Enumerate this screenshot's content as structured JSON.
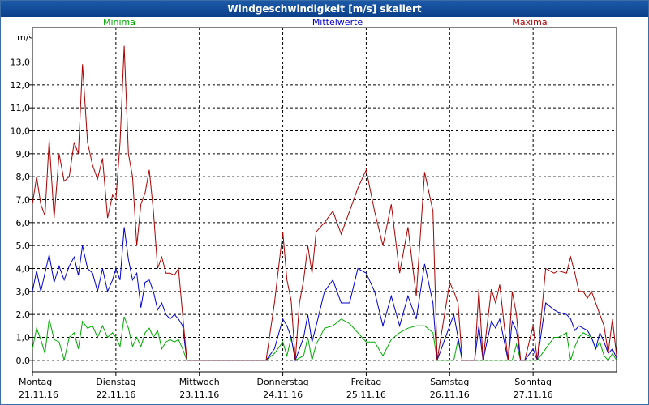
{
  "window": {
    "title": "Windgeschwindigkeit [m/s] skaliert"
  },
  "chart_data": {
    "type": "line",
    "ylabel": "m/s",
    "ylim": [
      -0.5,
      14.5
    ],
    "yticks": [
      "0,0",
      "1,0",
      "2,0",
      "3,0",
      "4,0",
      "5,0",
      "6,0",
      "7,0",
      "8,0",
      "9,0",
      "10,0",
      "11,0",
      "12,0",
      "13,0"
    ],
    "grid": true,
    "legend_position": "top",
    "xlim": [
      0,
      7
    ],
    "day_labels": [
      {
        "day": "Montag",
        "date": "21.11.16"
      },
      {
        "day": "Dienstag",
        "date": "22.11.16"
      },
      {
        "day": "Mittwoch",
        "date": "23.11.16"
      },
      {
        "day": "Donnerstag",
        "date": "24.11.16"
      },
      {
        "day": "Freitag",
        "date": "25.11.16"
      },
      {
        "day": "Samstag",
        "date": "26.11.16"
      },
      {
        "day": "Sonntag",
        "date": "27.11.16"
      }
    ],
    "series": [
      {
        "name": "Minima",
        "color": "#00aa00",
        "points": [
          [
            0,
            0.5
          ],
          [
            0.05,
            1.4
          ],
          [
            0.1,
            0.9
          ],
          [
            0.15,
            0.3
          ],
          [
            0.2,
            1.8
          ],
          [
            0.26,
            0.9
          ],
          [
            0.32,
            0.8
          ],
          [
            0.38,
            0.0
          ],
          [
            0.44,
            1.0
          ],
          [
            0.5,
            1.2
          ],
          [
            0.55,
            0.5
          ],
          [
            0.6,
            1.7
          ],
          [
            0.66,
            1.4
          ],
          [
            0.72,
            1.5
          ],
          [
            0.78,
            1.0
          ],
          [
            0.84,
            1.5
          ],
          [
            0.9,
            1.0
          ],
          [
            0.96,
            1.2
          ],
          [
            1.0,
            1.0
          ],
          [
            1.05,
            0.6
          ],
          [
            1.1,
            1.9
          ],
          [
            1.15,
            1.4
          ],
          [
            1.2,
            0.6
          ],
          [
            1.25,
            1.0
          ],
          [
            1.3,
            0.6
          ],
          [
            1.35,
            1.2
          ],
          [
            1.4,
            1.4
          ],
          [
            1.45,
            1.0
          ],
          [
            1.5,
            1.3
          ],
          [
            1.55,
            0.5
          ],
          [
            1.6,
            0.8
          ],
          [
            1.65,
            0.9
          ],
          [
            1.7,
            0.8
          ],
          [
            1.75,
            0.9
          ],
          [
            1.8,
            0.5
          ],
          [
            1.85,
            0.0
          ],
          [
            1.9,
            0.0
          ],
          [
            2.0,
            0.0
          ],
          [
            2.8,
            0.0
          ],
          [
            2.9,
            0.3
          ],
          [
            3.0,
            0.8
          ],
          [
            3.05,
            0.2
          ],
          [
            3.1,
            1.0
          ],
          [
            3.15,
            0.0
          ],
          [
            3.2,
            0.1
          ],
          [
            3.25,
            0.2
          ],
          [
            3.3,
            1.0
          ],
          [
            3.35,
            0.0
          ],
          [
            3.4,
            0.7
          ],
          [
            3.5,
            1.4
          ],
          [
            3.6,
            1.5
          ],
          [
            3.7,
            1.8
          ],
          [
            3.8,
            1.6
          ],
          [
            3.9,
            1.2
          ],
          [
            4.0,
            0.8
          ],
          [
            4.1,
            0.8
          ],
          [
            4.2,
            0.2
          ],
          [
            4.3,
            0.9
          ],
          [
            4.4,
            1.2
          ],
          [
            4.5,
            1.4
          ],
          [
            4.6,
            1.5
          ],
          [
            4.7,
            1.5
          ],
          [
            4.8,
            1.2
          ],
          [
            4.85,
            0.0
          ],
          [
            5.0,
            0.0
          ],
          [
            5.05,
            0.0
          ],
          [
            5.1,
            0.9
          ],
          [
            5.15,
            0.0
          ],
          [
            5.2,
            0.0
          ],
          [
            5.3,
            0.0
          ],
          [
            5.35,
            0.0
          ],
          [
            5.4,
            0.0
          ],
          [
            5.5,
            0.0
          ],
          [
            5.55,
            0.0
          ],
          [
            5.6,
            0.0
          ],
          [
            5.7,
            0.0
          ],
          [
            5.75,
            0.0
          ],
          [
            5.8,
            0.7
          ],
          [
            5.85,
            0.0
          ],
          [
            5.9,
            0.0
          ],
          [
            6.0,
            0.0
          ],
          [
            6.05,
            0.0
          ],
          [
            6.15,
            0.5
          ],
          [
            6.25,
            1.0
          ],
          [
            6.3,
            1.0
          ],
          [
            6.4,
            1.2
          ],
          [
            6.45,
            0.0
          ],
          [
            6.5,
            0.6
          ],
          [
            6.55,
            1.0
          ],
          [
            6.6,
            1.2
          ],
          [
            6.65,
            1.1
          ],
          [
            6.7,
            1.0
          ],
          [
            6.75,
            0.5
          ],
          [
            6.8,
            0.8
          ],
          [
            6.85,
            0.2
          ],
          [
            6.9,
            0.0
          ],
          [
            6.95,
            0.3
          ],
          [
            7.0,
            0.0
          ]
        ]
      },
      {
        "name": "Mittelwerte",
        "color": "#0000cc",
        "points": [
          [
            0,
            3.0
          ],
          [
            0.05,
            3.9
          ],
          [
            0.1,
            3.0
          ],
          [
            0.15,
            3.8
          ],
          [
            0.2,
            4.6
          ],
          [
            0.26,
            3.4
          ],
          [
            0.32,
            4.1
          ],
          [
            0.38,
            3.5
          ],
          [
            0.44,
            4.1
          ],
          [
            0.5,
            4.5
          ],
          [
            0.55,
            3.7
          ],
          [
            0.6,
            5.0
          ],
          [
            0.66,
            4.0
          ],
          [
            0.72,
            3.8
          ],
          [
            0.78,
            3.0
          ],
          [
            0.84,
            4.0
          ],
          [
            0.9,
            3.0
          ],
          [
            0.96,
            3.5
          ],
          [
            1.0,
            4.0
          ],
          [
            1.05,
            3.5
          ],
          [
            1.1,
            5.8
          ],
          [
            1.15,
            4.4
          ],
          [
            1.2,
            3.5
          ],
          [
            1.25,
            3.8
          ],
          [
            1.3,
            2.3
          ],
          [
            1.35,
            3.4
          ],
          [
            1.4,
            3.5
          ],
          [
            1.45,
            3.0
          ],
          [
            1.5,
            2.2
          ],
          [
            1.55,
            2.5
          ],
          [
            1.6,
            2.0
          ],
          [
            1.65,
            1.8
          ],
          [
            1.7,
            2.0
          ],
          [
            1.75,
            1.8
          ],
          [
            1.8,
            1.5
          ],
          [
            1.85,
            0.0
          ],
          [
            1.9,
            0.0
          ],
          [
            2.0,
            0.0
          ],
          [
            2.8,
            0.0
          ],
          [
            2.9,
            0.5
          ],
          [
            3.0,
            1.8
          ],
          [
            3.05,
            1.5
          ],
          [
            3.1,
            1.0
          ],
          [
            3.15,
            0.0
          ],
          [
            3.2,
            0.5
          ],
          [
            3.25,
            1.0
          ],
          [
            3.3,
            2.0
          ],
          [
            3.35,
            0.8
          ],
          [
            3.4,
            1.5
          ],
          [
            3.5,
            3.0
          ],
          [
            3.6,
            3.5
          ],
          [
            3.7,
            2.5
          ],
          [
            3.8,
            2.5
          ],
          [
            3.9,
            4.0
          ],
          [
            4.0,
            3.8
          ],
          [
            4.1,
            3.0
          ],
          [
            4.2,
            1.5
          ],
          [
            4.3,
            2.8
          ],
          [
            4.4,
            1.5
          ],
          [
            4.5,
            2.8
          ],
          [
            4.6,
            1.8
          ],
          [
            4.7,
            4.2
          ],
          [
            4.8,
            2.5
          ],
          [
            4.85,
            0.0
          ],
          [
            5.0,
            1.5
          ],
          [
            5.05,
            2.0
          ],
          [
            5.1,
            1.0
          ],
          [
            5.15,
            0.0
          ],
          [
            5.2,
            0.0
          ],
          [
            5.3,
            0.0
          ],
          [
            5.35,
            1.5
          ],
          [
            5.4,
            0.0
          ],
          [
            5.5,
            1.7
          ],
          [
            5.55,
            1.4
          ],
          [
            5.6,
            1.8
          ],
          [
            5.7,
            0.0
          ],
          [
            5.75,
            1.7
          ],
          [
            5.8,
            1.3
          ],
          [
            5.85,
            0.0
          ],
          [
            5.9,
            0.0
          ],
          [
            6.0,
            0.5
          ],
          [
            6.05,
            0.0
          ],
          [
            6.15,
            2.5
          ],
          [
            6.25,
            2.2
          ],
          [
            6.3,
            2.1
          ],
          [
            6.4,
            2.0
          ],
          [
            6.45,
            1.8
          ],
          [
            6.5,
            1.3
          ],
          [
            6.55,
            1.5
          ],
          [
            6.6,
            1.4
          ],
          [
            6.65,
            1.3
          ],
          [
            6.7,
            1.0
          ],
          [
            6.75,
            0.5
          ],
          [
            6.8,
            1.2
          ],
          [
            6.85,
            0.8
          ],
          [
            6.9,
            0.3
          ],
          [
            6.95,
            0.5
          ],
          [
            7.0,
            0.1
          ]
        ]
      },
      {
        "name": "Maxima",
        "color": "#aa0000",
        "points": [
          [
            0,
            6.8
          ],
          [
            0.05,
            8.0
          ],
          [
            0.1,
            6.8
          ],
          [
            0.15,
            6.3
          ],
          [
            0.2,
            9.6
          ],
          [
            0.26,
            6.2
          ],
          [
            0.32,
            9.0
          ],
          [
            0.38,
            7.8
          ],
          [
            0.44,
            8.0
          ],
          [
            0.5,
            9.5
          ],
          [
            0.55,
            9.0
          ],
          [
            0.6,
            12.9
          ],
          [
            0.66,
            9.5
          ],
          [
            0.72,
            8.5
          ],
          [
            0.78,
            7.9
          ],
          [
            0.84,
            8.8
          ],
          [
            0.9,
            6.2
          ],
          [
            0.96,
            7.2
          ],
          [
            1.0,
            7.0
          ],
          [
            1.05,
            9.5
          ],
          [
            1.1,
            13.7
          ],
          [
            1.15,
            9.0
          ],
          [
            1.2,
            8.0
          ],
          [
            1.25,
            5.0
          ],
          [
            1.3,
            6.8
          ],
          [
            1.35,
            7.3
          ],
          [
            1.4,
            8.3
          ],
          [
            1.45,
            6.5
          ],
          [
            1.5,
            4.0
          ],
          [
            1.55,
            4.5
          ],
          [
            1.6,
            3.8
          ],
          [
            1.65,
            3.8
          ],
          [
            1.7,
            3.7
          ],
          [
            1.75,
            4.0
          ],
          [
            1.8,
            2.0
          ],
          [
            1.85,
            0.0
          ],
          [
            1.9,
            0.0
          ],
          [
            2.0,
            0.0
          ],
          [
            2.8,
            0.0
          ],
          [
            2.9,
            2.5
          ],
          [
            3.0,
            5.6
          ],
          [
            3.05,
            3.5
          ],
          [
            3.1,
            2.6
          ],
          [
            3.15,
            0.0
          ],
          [
            3.2,
            2.5
          ],
          [
            3.25,
            3.5
          ],
          [
            3.3,
            5.0
          ],
          [
            3.35,
            3.8
          ],
          [
            3.4,
            5.6
          ],
          [
            3.5,
            6.0
          ],
          [
            3.6,
            6.5
          ],
          [
            3.7,
            5.5
          ],
          [
            3.8,
            6.5
          ],
          [
            3.9,
            7.5
          ],
          [
            4.0,
            8.3
          ],
          [
            4.1,
            6.5
          ],
          [
            4.2,
            5.0
          ],
          [
            4.3,
            6.8
          ],
          [
            4.4,
            3.8
          ],
          [
            4.5,
            5.8
          ],
          [
            4.6,
            2.8
          ],
          [
            4.7,
            8.2
          ],
          [
            4.8,
            6.5
          ],
          [
            4.85,
            0.0
          ],
          [
            5.0,
            3.4
          ],
          [
            5.05,
            3.0
          ],
          [
            5.1,
            2.5
          ],
          [
            5.15,
            0.0
          ],
          [
            5.2,
            0.0
          ],
          [
            5.3,
            0.0
          ],
          [
            5.35,
            3.1
          ],
          [
            5.4,
            0.0
          ],
          [
            5.5,
            3.1
          ],
          [
            5.55,
            2.5
          ],
          [
            5.6,
            3.3
          ],
          [
            5.7,
            0.0
          ],
          [
            5.75,
            3.0
          ],
          [
            5.8,
            2.0
          ],
          [
            5.85,
            0.0
          ],
          [
            5.9,
            0.0
          ],
          [
            6.0,
            1.5
          ],
          [
            6.05,
            0.0
          ],
          [
            6.15,
            4.0
          ],
          [
            6.25,
            3.8
          ],
          [
            6.3,
            3.9
          ],
          [
            6.4,
            3.8
          ],
          [
            6.45,
            4.5
          ],
          [
            6.5,
            3.8
          ],
          [
            6.55,
            3.0
          ],
          [
            6.6,
            3.0
          ],
          [
            6.65,
            2.7
          ],
          [
            6.7,
            3.0
          ],
          [
            6.75,
            2.5
          ],
          [
            6.8,
            2.0
          ],
          [
            6.85,
            1.5
          ],
          [
            6.9,
            0.3
          ],
          [
            6.95,
            1.8
          ],
          [
            7.0,
            0.2
          ]
        ]
      }
    ]
  }
}
